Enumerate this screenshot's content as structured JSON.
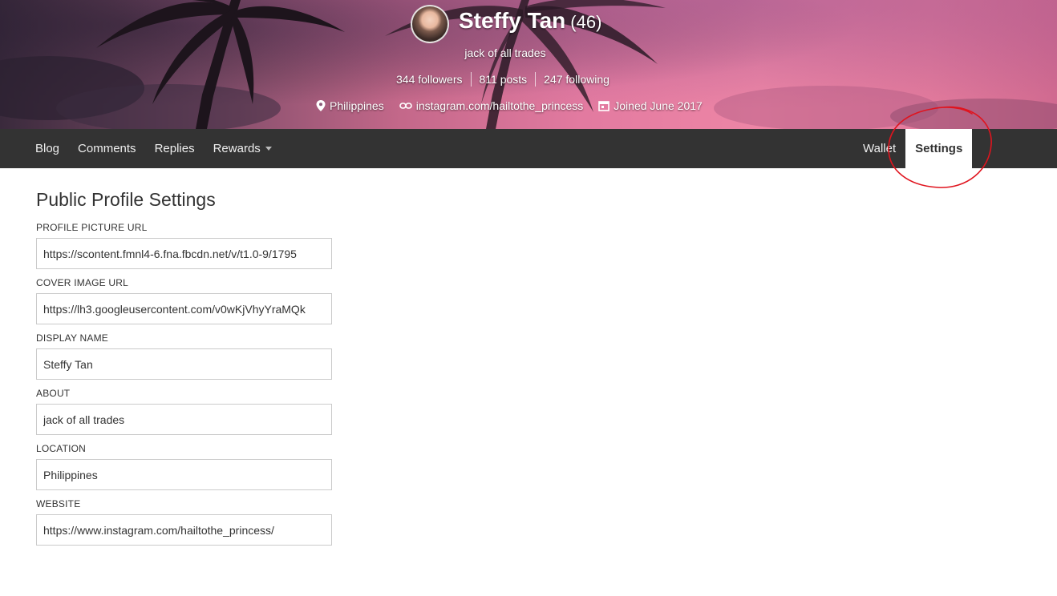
{
  "profile": {
    "name": "Steffy Tan",
    "reputation": "(46)",
    "about": "jack of all trades",
    "followers": "344 followers",
    "posts": "811 posts",
    "following": "247 following",
    "location": "Philippines",
    "website": "instagram.com/hailtothe_princess",
    "joined": "Joined June 2017"
  },
  "nav": {
    "left": [
      {
        "label": "Blog"
      },
      {
        "label": "Comments"
      },
      {
        "label": "Replies"
      },
      {
        "label": "Rewards"
      }
    ],
    "right": [
      {
        "label": "Wallet"
      },
      {
        "label": "Settings"
      }
    ]
  },
  "settings": {
    "title": "Public Profile Settings",
    "fields": [
      {
        "label": "PROFILE PICTURE URL",
        "value": "https://scontent.fmnl4-6.fna.fbcdn.net/v/t1.0-9/1795"
      },
      {
        "label": "COVER IMAGE URL",
        "value": "https://lh3.googleusercontent.com/v0wKjVhyYraMQk"
      },
      {
        "label": "DISPLAY NAME",
        "value": "Steffy Tan"
      },
      {
        "label": "ABOUT",
        "value": "jack of all trades"
      },
      {
        "label": "LOCATION",
        "value": "Philippines"
      },
      {
        "label": "WEBSITE",
        "value": "https://www.instagram.com/hailtothe_princess/"
      }
    ]
  },
  "colors": {
    "navbar": "#333333",
    "annotation": "#e0141e"
  }
}
